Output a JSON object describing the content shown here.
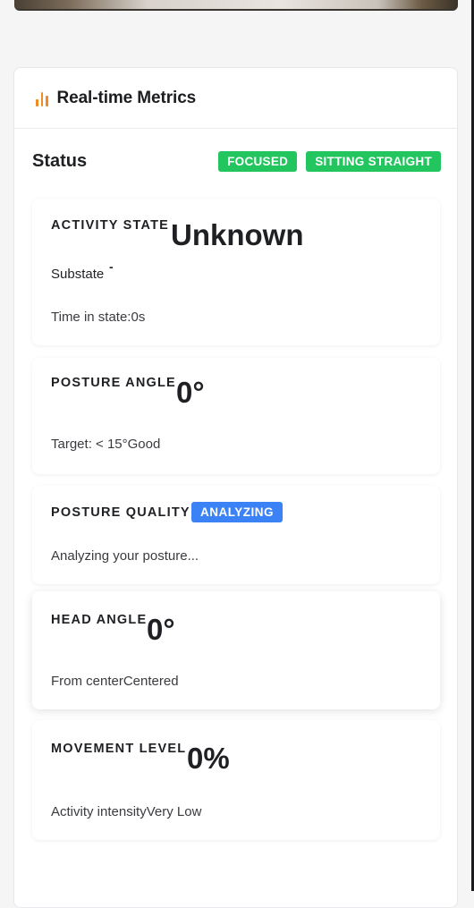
{
  "panel": {
    "title": "Real-time Metrics"
  },
  "status": {
    "title": "Status",
    "badges": [
      "FOCUSED",
      "SITTING STRAIGHT"
    ]
  },
  "activity": {
    "label": "ACTIVITY STATE",
    "value": "Unknown",
    "substate_label": "Substate",
    "substate_value": "-",
    "time_text": "Time in state:0s"
  },
  "posture_angle": {
    "label": "POSTURE ANGLE",
    "value": "0°",
    "footer": "Target: < 15°Good"
  },
  "posture_quality": {
    "label": "POSTURE QUALITY",
    "badge": "ANALYZING",
    "footer": "Analyzing your posture..."
  },
  "head_angle": {
    "label": "HEAD ANGLE",
    "value": "0°",
    "footer": "From centerCentered"
  },
  "movement": {
    "label": "MOVEMENT LEVEL",
    "value": "0%",
    "footer": "Activity intensityVery Low"
  },
  "colors": {
    "accent_orange": "#f08a24",
    "status_green": "#22c55e",
    "analyzing_blue": "#3b82f6"
  }
}
